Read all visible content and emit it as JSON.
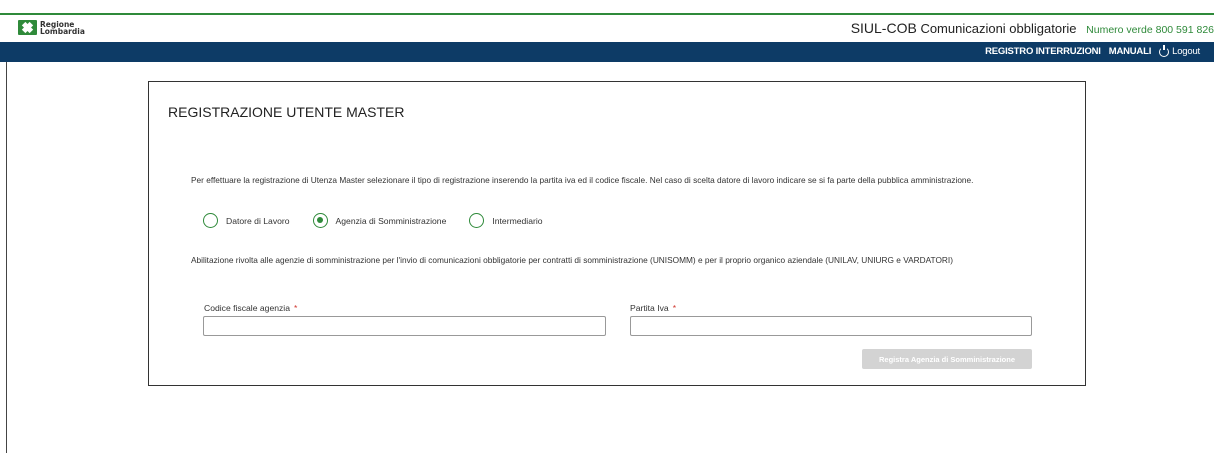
{
  "header": {
    "logo_line1": "Regione",
    "logo_line2": "Lombardia",
    "app_name": "SIUL-COB",
    "app_subtitle": "Comunicazioni obbligatorie",
    "toll_free": "Numero verde 800 591 826"
  },
  "nav": {
    "items": [
      {
        "label": "REGISTRO INTERRUZIONI"
      },
      {
        "label": "MANUALI"
      }
    ],
    "logout_label": "Logout"
  },
  "form": {
    "title": "REGISTRAZIONE UTENTE MASTER",
    "intro": "Per effettuare la registrazione di Utenza Master selezionare il tipo di registrazione inserendo la partita iva ed il codice fiscale. Nel caso di scelta datore di lavoro indicare se si fa parte della pubblica amministrazione.",
    "registration_types": [
      {
        "label": "Datore di Lavoro",
        "selected": false
      },
      {
        "label": "Agenzia di Somministrazione",
        "selected": true
      },
      {
        "label": "Intermediario",
        "selected": false
      }
    ],
    "description": "Abilitazione rivolta alle agenzie di somministrazione per l'invio di comunicazioni obbligatorie per contratti di somministrazione (UNISOMM) e per il proprio organico aziendale (UNILAV, UNIURG e VARDATORI)",
    "fields": {
      "codice_fiscale": {
        "label": "Codice fiscale agenzia",
        "required_mark": "*",
        "value": ""
      },
      "partita_iva": {
        "label": "Partita Iva",
        "required_mark": "*",
        "value": ""
      }
    },
    "submit_label": "Registra Agenzia di Somministrazione",
    "submit_disabled": true
  },
  "colors": {
    "brand_green": "#2f8a3a",
    "navbar_blue": "#0d3b66",
    "required_red": "#d0342c",
    "disabled_button": "#d3d3d3"
  }
}
